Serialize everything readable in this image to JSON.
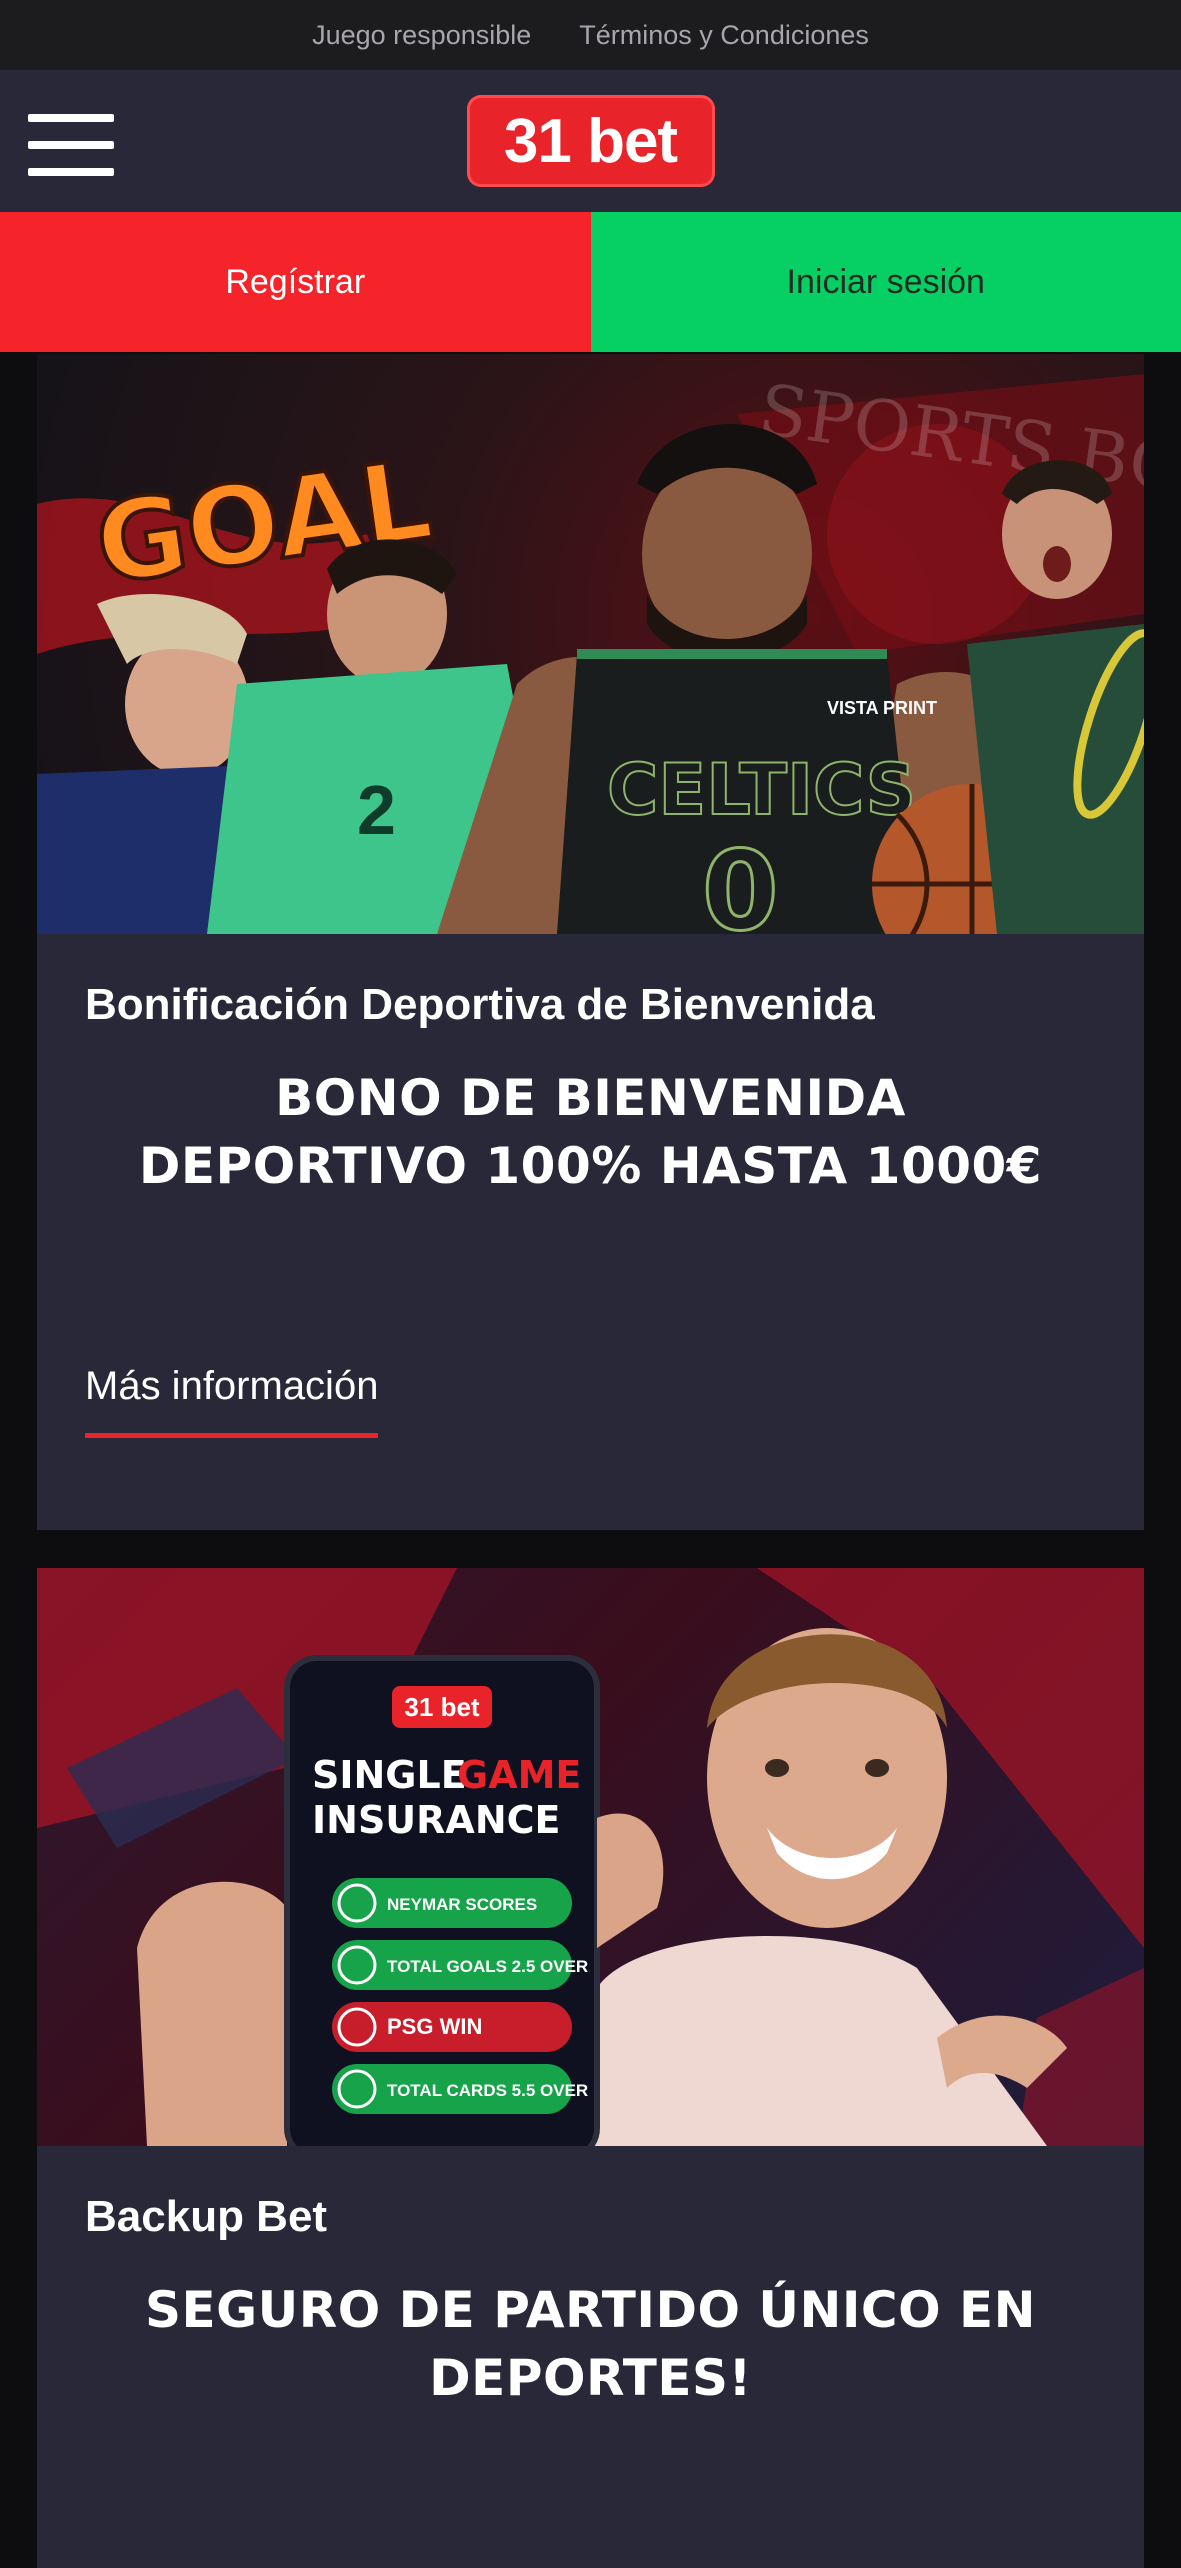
{
  "topbar": {
    "link1": "Juego responsible",
    "link2": "Términos y Condiciones"
  },
  "header": {
    "logo_text": "31 bet",
    "menu_icon": "hamburger-icon"
  },
  "auth": {
    "register_label": "Regístrar",
    "login_label": "Iniciar sesión",
    "register_color": "#f5242a",
    "login_color": "#06d063"
  },
  "promos": [
    {
      "title": "Bonificación Deportiva de Bienvenida",
      "promo_line1": "BONO DE BIENVENIDA",
      "promo_line2": "DEPORTIVO 100% HASTA 1000€",
      "link_label": "Más información",
      "banner": {
        "graffiti": "GOAL",
        "jersey_text": "CELTICS",
        "jersey_number": "0",
        "sponsor": "VISTA PRINT",
        "watermark": "SPORTS BONUS"
      }
    },
    {
      "title": "Backup Bet",
      "promo_line1": "SEGURO DE PARTIDO ÚNICO EN",
      "promo_line2": "DEPORTES!",
      "banner": {
        "phone_logo": "31 bet",
        "heading_1": "SINGLE",
        "heading_2": "GAME",
        "heading_3": "INSURANCE",
        "bets": [
          {
            "text": "NEYMAR SCORES",
            "status": "win"
          },
          {
            "text": "TOTAL GOALS 2.5 OVER",
            "status": "win"
          },
          {
            "text": "PSG WIN",
            "status": "lose"
          },
          {
            "text": "TOTAL CARDS 5.5 OVER",
            "status": "win"
          }
        ]
      }
    }
  ]
}
